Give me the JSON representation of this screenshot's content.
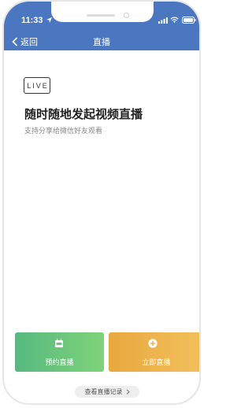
{
  "status_bar": {
    "time": "11:33"
  },
  "nav": {
    "back_label": "返回",
    "title": "直播"
  },
  "content": {
    "live_badge": "LIVE",
    "headline": "随时随地发起视频直播",
    "subline": "支持分享给微信好友观看"
  },
  "actions": {
    "schedule_label": "预约直播",
    "live_now_label": "立即直播"
  },
  "footer": {
    "history_label": "查看直播记录"
  },
  "colors": {
    "header": "#4a77c0",
    "schedule_button": "#6cc67c",
    "live_now_button": "#eeb24b"
  }
}
